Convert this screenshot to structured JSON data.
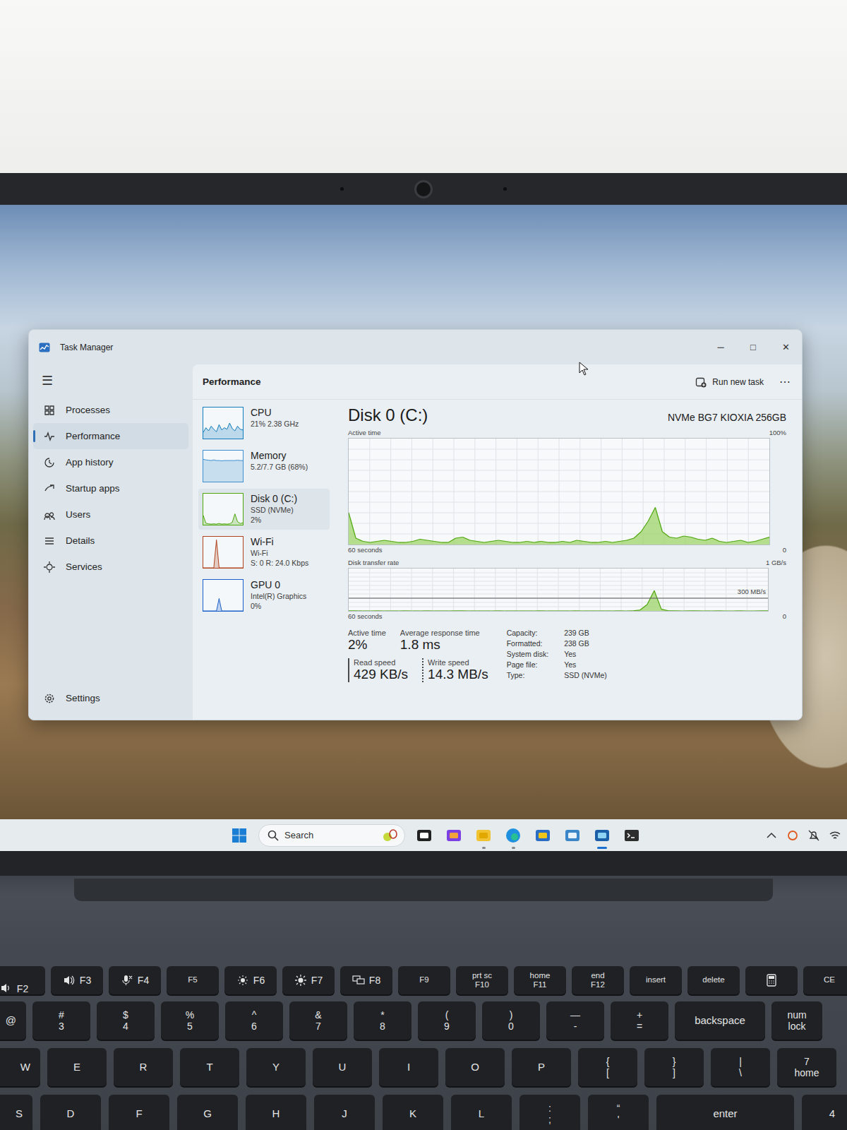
{
  "window": {
    "title": "Task Manager",
    "controls": [
      "─",
      "□",
      "✕"
    ]
  },
  "sidebar": {
    "menu_icon": "☰",
    "items": [
      {
        "label": "Processes",
        "selected": false
      },
      {
        "label": "Performance",
        "selected": true
      },
      {
        "label": "App history",
        "selected": false
      },
      {
        "label": "Startup apps",
        "selected": false
      },
      {
        "label": "Users",
        "selected": false
      },
      {
        "label": "Details",
        "selected": false
      },
      {
        "label": "Services",
        "selected": false
      }
    ],
    "settings": "Settings"
  },
  "header": {
    "title": "Performance",
    "run_new_task": "Run new task",
    "more": "⋯"
  },
  "resources": [
    {
      "name": "CPU",
      "lines": [
        "21% 2.38 GHz"
      ],
      "selected": false,
      "color": "#117dbb",
      "series": [
        20,
        35,
        25,
        40,
        30,
        22,
        45,
        28,
        35,
        30,
        50,
        32,
        25,
        40,
        30,
        28
      ]
    },
    {
      "name": "Memory",
      "lines": [
        "5.2/7.7 GB (68%)"
      ],
      "selected": false,
      "color": "#3f8fd0",
      "series": [
        72,
        70,
        69,
        68,
        70,
        68,
        68,
        67,
        68,
        68,
        68,
        68,
        68,
        69,
        68,
        68
      ]
    },
    {
      "name": "Disk 0 (C:)",
      "lines": [
        "SSD (NVMe)",
        "2%"
      ],
      "selected": true,
      "color": "#4da60c",
      "series": [
        30,
        5,
        3,
        2,
        3,
        2,
        4,
        2,
        3,
        2,
        3,
        8,
        35,
        10,
        4,
        6
      ]
    },
    {
      "name": "Wi-Fi",
      "lines": [
        "Wi-Fi",
        "S: 0 R: 24.0 Kbps"
      ],
      "selected": false,
      "color": "#b0431d",
      "series": [
        0,
        0,
        0,
        0,
        0,
        90,
        0,
        0,
        0,
        0,
        0,
        0,
        0,
        0,
        0,
        0
      ]
    },
    {
      "name": "GPU 0",
      "lines": [
        "Intel(R) Graphics",
        "0%"
      ],
      "selected": false,
      "color": "#1a5fc9",
      "series": [
        0,
        0,
        0,
        0,
        0,
        0,
        40,
        0,
        0,
        0,
        0,
        0,
        0,
        0,
        0,
        0
      ]
    }
  ],
  "disk": {
    "title": "Disk 0 (C:)",
    "model": "NVMe BG7 KIOXIA 256GB",
    "active_chart": {
      "label": "Active time",
      "max_label": "100%",
      "x_label": "60 seconds",
      "min_label": "0",
      "max": 100,
      "values": [
        30,
        6,
        3,
        2,
        3,
        4,
        3,
        2,
        2,
        3,
        5,
        4,
        3,
        2,
        2,
        6,
        7,
        4,
        3,
        2,
        3,
        4,
        3,
        2,
        2,
        3,
        2,
        3,
        2,
        2,
        3,
        2,
        4,
        3,
        2,
        2,
        3,
        2,
        3,
        4,
        6,
        12,
        22,
        35,
        12,
        7,
        6,
        8,
        7,
        5,
        4,
        6,
        3,
        2,
        3,
        4,
        2,
        3,
        5,
        7
      ]
    },
    "transfer_chart": {
      "label": "Disk transfer rate",
      "max_label": "1 GB/s",
      "ref_label": "300 MB/s",
      "ref": 300,
      "x_label": "60 seconds",
      "min_label": "0",
      "max": 1000,
      "values": [
        2,
        1,
        0,
        0,
        1,
        0,
        0,
        0,
        1,
        0,
        0,
        1,
        0,
        0,
        0,
        1,
        2,
        0,
        0,
        0,
        0,
        1,
        0,
        0,
        0,
        0,
        0,
        1,
        0,
        0,
        0,
        0,
        1,
        0,
        0,
        0,
        0,
        0,
        1,
        0,
        2,
        20,
        150,
        480,
        40,
        3,
        1,
        0,
        2,
        1,
        0,
        0,
        1,
        0,
        0,
        1,
        0,
        0,
        1,
        2
      ]
    }
  },
  "summary": [
    {
      "label": "Active time",
      "value": "2%"
    },
    {
      "label": "Average response time",
      "value": "1.8 ms"
    }
  ],
  "speeds": [
    {
      "label": "Read speed",
      "value": "429 KB/s",
      "kind": "solid"
    },
    {
      "label": "Write speed",
      "value": "14.3 MB/s",
      "kind": "dotted"
    }
  ],
  "properties": [
    {
      "label": "Capacity:",
      "value": "239 GB"
    },
    {
      "label": "Formatted:",
      "value": "238 GB"
    },
    {
      "label": "System disk:",
      "value": "Yes"
    },
    {
      "label": "Page file:",
      "value": "Yes"
    },
    {
      "label": "Type:",
      "value": "SSD (NVMe)"
    }
  ],
  "taskbar": {
    "search": "Search"
  },
  "keyboard": {
    "rows": [
      {
        "keys": [
          {
            "kind": "icon-fn",
            "bottom": "F2"
          },
          {
            "kind": "icon-fn",
            "bottom": "F3"
          },
          {
            "kind": "icon-fn",
            "bottom": "F4"
          },
          {
            "kind": "single",
            "main": "F5"
          },
          {
            "kind": "icon-fn",
            "bottom": "F6"
          },
          {
            "kind": "icon-fn",
            "bottom": "F7"
          },
          {
            "kind": "icon-fn",
            "bottom": "F8"
          },
          {
            "kind": "single",
            "main": "F9"
          },
          {
            "kind": "dual",
            "top": "prt sc",
            "bottom": "F10"
          },
          {
            "kind": "dual",
            "top": "home",
            "bottom": "F11"
          },
          {
            "kind": "dual",
            "top": "end",
            "bottom": "F12"
          },
          {
            "kind": "single",
            "main": "insert"
          },
          {
            "kind": "single",
            "main": "delete"
          },
          {
            "kind": "icon"
          },
          {
            "kind": "single",
            "main": "CE"
          }
        ]
      },
      {
        "keys": [
          {
            "kind": "single",
            "main": "@"
          },
          {
            "kind": "dual",
            "top": "#",
            "bottom": "3"
          },
          {
            "kind": "dual",
            "top": "$",
            "bottom": "4"
          },
          {
            "kind": "dual",
            "top": "%",
            "bottom": "5"
          },
          {
            "kind": "dual",
            "top": "^",
            "bottom": "6"
          },
          {
            "kind": "dual",
            "top": "&",
            "bottom": "7"
          },
          {
            "kind": "dual",
            "top": "*",
            "bottom": "8"
          },
          {
            "kind": "dual",
            "top": "(",
            "bottom": "9"
          },
          {
            "kind": "dual",
            "top": ")",
            "bottom": "0"
          },
          {
            "kind": "dual",
            "top": "—",
            "bottom": "-"
          },
          {
            "kind": "dual",
            "top": "+",
            "bottom": "="
          },
          {
            "kind": "single",
            "main": "backspace"
          },
          {
            "kind": "dual",
            "top": "num",
            "bottom": "lock"
          }
        ]
      },
      {
        "keys": [
          {
            "kind": "single",
            "main": "W"
          },
          {
            "kind": "single",
            "main": "E"
          },
          {
            "kind": "single",
            "main": "R"
          },
          {
            "kind": "single",
            "main": "T"
          },
          {
            "kind": "single",
            "main": "Y"
          },
          {
            "kind": "single",
            "main": "U"
          },
          {
            "kind": "single",
            "main": "I"
          },
          {
            "kind": "single",
            "main": "O"
          },
          {
            "kind": "single",
            "main": "P"
          },
          {
            "kind": "dual",
            "top": "{",
            "bottom": "["
          },
          {
            "kind": "dual",
            "top": "}",
            "bottom": "]"
          },
          {
            "kind": "dual",
            "top": "|",
            "bottom": "\\"
          },
          {
            "kind": "dual",
            "top": "7",
            "bottom": "home"
          }
        ]
      },
      {
        "keys": [
          {
            "kind": "single",
            "main": "S"
          },
          {
            "kind": "single",
            "main": "D"
          },
          {
            "kind": "single",
            "main": "F"
          },
          {
            "kind": "single",
            "main": "G"
          },
          {
            "kind": "single",
            "main": "H"
          },
          {
            "kind": "single",
            "main": "J"
          },
          {
            "kind": "single",
            "main": "K"
          },
          {
            "kind": "single",
            "main": "L"
          },
          {
            "kind": "dual",
            "top": ":",
            "bottom": ";"
          },
          {
            "kind": "dual",
            "top": "“",
            "bottom": "'"
          },
          {
            "kind": "single",
            "main": "enter"
          },
          {
            "kind": "single",
            "main": "4"
          }
        ]
      }
    ]
  }
}
